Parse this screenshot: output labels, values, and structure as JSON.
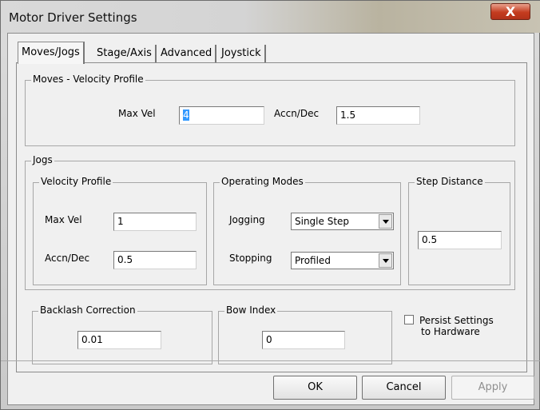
{
  "window": {
    "title": "Motor Driver Settings",
    "close_glyph": "X"
  },
  "tabs": [
    {
      "label": "Moves/Jogs"
    },
    {
      "label": "Stage/Axis"
    },
    {
      "label": "Advanced"
    },
    {
      "label": "Joystick"
    }
  ],
  "moves": {
    "legend": "Moves - Velocity Profile",
    "max_vel_label": "Max Vel",
    "max_vel_value": "4",
    "accn_label": "Accn/Dec",
    "accn_value": "1.5"
  },
  "jogs": {
    "legend": "Jogs",
    "velocity_profile": {
      "legend": "Velocity Profile",
      "max_vel_label": "Max Vel",
      "max_vel_value": "1",
      "accn_label": "Accn/Dec",
      "accn_value": "0.5"
    },
    "operating_modes": {
      "legend": "Operating Modes",
      "jogging_label": "Jogging",
      "jogging_value": "Single Step",
      "stopping_label": "Stopping",
      "stopping_value": "Profiled"
    },
    "step_distance": {
      "legend": "Step Distance",
      "value": "0.5"
    }
  },
  "backlash": {
    "legend": "Backlash Correction",
    "value": "0.01"
  },
  "bow": {
    "legend": "Bow Index",
    "value": "0"
  },
  "persist": {
    "label_line1": "Persist Settings",
    "label_line2": "to Hardware",
    "checked": false
  },
  "buttons": {
    "ok": "OK",
    "cancel": "Cancel",
    "apply": "Apply"
  }
}
